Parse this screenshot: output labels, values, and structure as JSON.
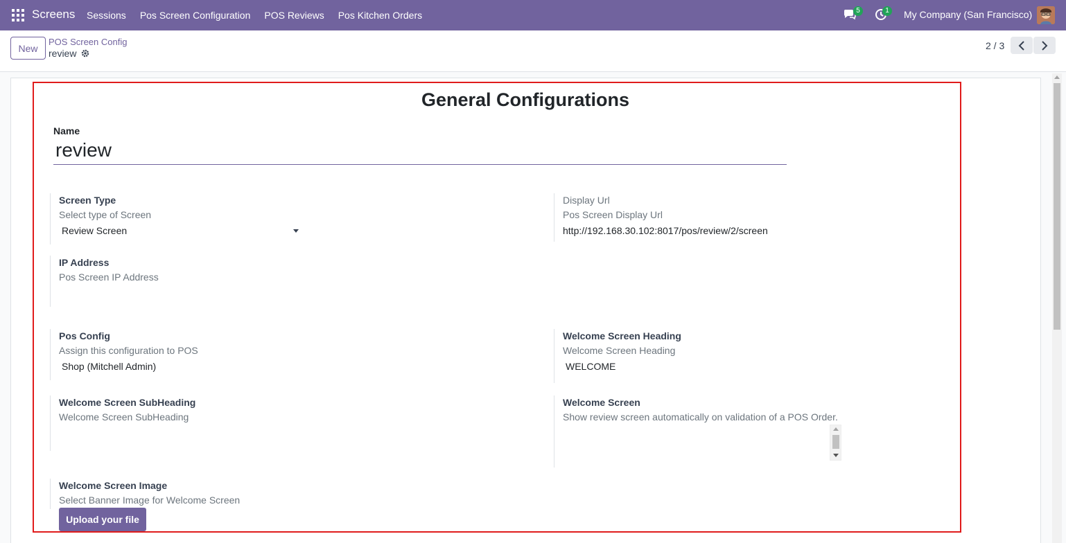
{
  "navbar": {
    "brand": "Screens",
    "menu": [
      "Sessions",
      "Pos Screen Configuration",
      "POS Reviews",
      "Pos Kitchen Orders"
    ],
    "messages_count": "5",
    "activities_count": "1",
    "company": "My Company (San Francisco)"
  },
  "control": {
    "new_label": "New",
    "breadcrumb": "POS Screen Config",
    "record_name": "review",
    "pager": "2 / 3"
  },
  "form": {
    "title": "General Configurations",
    "name_label": "Name",
    "name_value": "review",
    "screen_type": {
      "label": "Screen Type",
      "help": "Select type of Screen",
      "value": "Review Screen"
    },
    "display_url": {
      "label": "Display Url",
      "help": "Pos Screen Display Url",
      "value": "http://192.168.30.102:8017/pos/review/2/screen"
    },
    "ip_address": {
      "label": "IP Address",
      "help": "Pos Screen IP Address",
      "value": ""
    },
    "pos_config": {
      "label": "Pos Config",
      "help": "Assign this configuration to POS",
      "value": "Shop (Mitchell Admin)"
    },
    "welcome_heading": {
      "label": "Welcome Screen Heading",
      "help": "Welcome Screen Heading",
      "value": "WELCOME"
    },
    "welcome_subheading": {
      "label": "Welcome Screen SubHeading",
      "help": "Welcome Screen SubHeading",
      "value": ""
    },
    "welcome_screen": {
      "label": "Welcome Screen",
      "help": "Show review screen automatically on validation of a POS Order."
    },
    "welcome_image": {
      "label": "Welcome Screen Image",
      "help": "Select Banner Image for Welcome Screen",
      "button": "Upload your file"
    }
  },
  "colors": {
    "brand": "#71639e",
    "highlight": "#e01b1b",
    "badge": "#22a358"
  }
}
